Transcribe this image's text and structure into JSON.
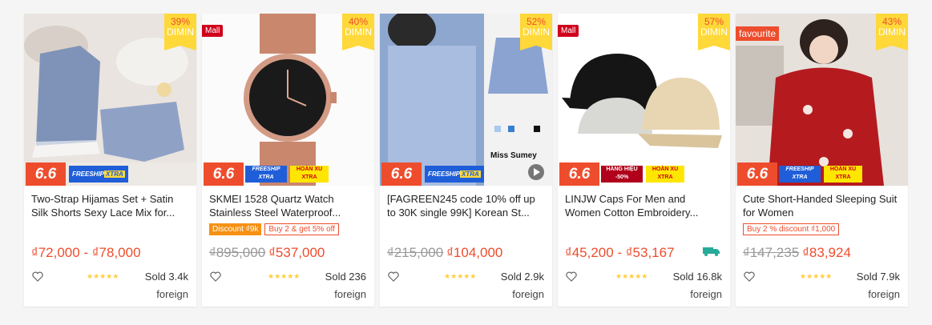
{
  "products": [
    {
      "discount_pct": "39%",
      "discount_word": "DIMIN",
      "badge": "",
      "promo_badges": [
        "FREESHIP",
        "XTRA"
      ],
      "title": "Two-Strap Hijamas Set + Satin Silk Shorts Sexy Lace Mix for...",
      "tags": [],
      "price_old": "",
      "price": "₫72,000 - ₫78,000",
      "rating": 5,
      "sold": "Sold 3.4k",
      "origin": "foreign"
    },
    {
      "discount_pct": "40%",
      "discount_word": "DIMIN",
      "badge": "Mall",
      "promo_badges": [
        "FREESHIP XTRA",
        "HOÀN XU XTRA"
      ],
      "title": "SKMEI 1528 Quartz Watch Stainless Steel Waterproof...",
      "tags": [
        "Discount ₫9k",
        "Buy 2 & get 5% off"
      ],
      "price_old": "₫895,000",
      "price": "₫537,000",
      "rating": 5,
      "sold": "Sold 236",
      "origin": "foreign"
    },
    {
      "discount_pct": "52%",
      "discount_word": "DIMIN",
      "badge": "",
      "promo_badges": [
        "FREESHIP",
        "XTRA"
      ],
      "title": "[FAGREEN245 code 10% off up to 30K single 99K] Korean St...",
      "tags": [],
      "price_old": "₫215,000",
      "price": "₫104,000",
      "rating": 5,
      "sold": "Sold 2.9k",
      "origin": "foreign",
      "image_caption": "Miss Sumey"
    },
    {
      "discount_pct": "57%",
      "discount_word": "DIMIN",
      "badge": "Mall",
      "promo_badges": [
        "HÀNG HIỆU -50%",
        "HOÀN XU XTRA"
      ],
      "title": "LINJW Caps For Men and Women Cotton Embroidery...",
      "tags": [],
      "price_old": "",
      "price": "₫45,200 - ₫53,167",
      "rating": 5,
      "sold": "Sold 16.8k",
      "origin": "foreign"
    },
    {
      "discount_pct": "43%",
      "discount_word": "DIMIN",
      "badge": "favourite",
      "promo_badges": [
        "FREESHIP XTRA",
        "HOÀN XU XTRA"
      ],
      "title": "Cute Short-Handed Sleeping Suit for Women",
      "tags": [
        "Buy 2 % discount ₫1,000"
      ],
      "price_old": "₫147,235",
      "price": "₫83,924",
      "rating": 5,
      "sold": "Sold 7.9k",
      "origin": "foreign"
    }
  ],
  "six_six_label": "6.6",
  "colors": {
    "accent": "#ee4d2d",
    "star": "#ffce3d",
    "badge": "#ffd839"
  }
}
